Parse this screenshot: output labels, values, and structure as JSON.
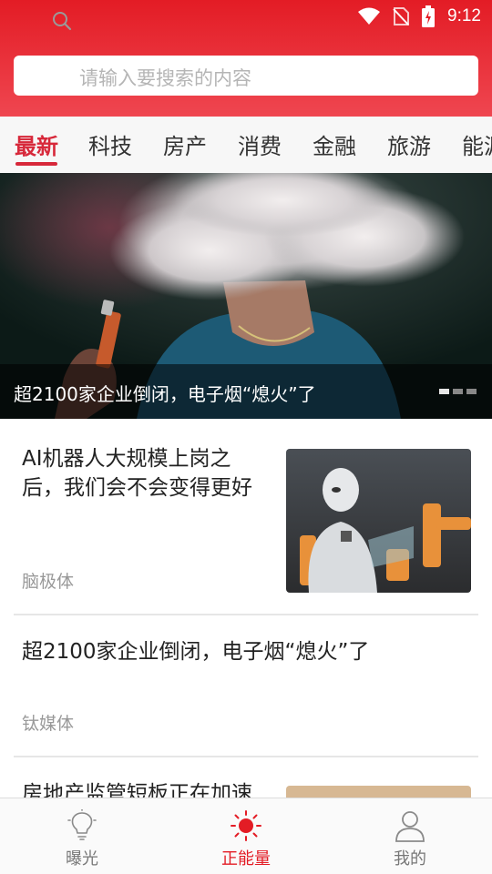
{
  "status_bar": {
    "time": "9:12",
    "icons": [
      "wifi-icon",
      "no-sim-icon",
      "battery-charging-icon"
    ]
  },
  "search": {
    "placeholder": "请输入要搜索的内容",
    "icon": "search-icon"
  },
  "tabs": [
    {
      "label": "最新",
      "active": true
    },
    {
      "label": "科技"
    },
    {
      "label": "房产"
    },
    {
      "label": "消费"
    },
    {
      "label": "金融"
    },
    {
      "label": "旅游"
    },
    {
      "label": "能源"
    }
  ],
  "banner": {
    "caption": "超2100家企业倒闭，电子烟“熄火”了",
    "slide_count": 3,
    "active_slide": 1
  },
  "news": [
    {
      "title_line1": "AI机器人大规模上岗之",
      "title_line2": "后，我们会不会变得更好",
      "source": "脑极体",
      "has_image": true
    },
    {
      "title_line1": "超2100家企业倒闭，电子烟“熄火”了",
      "source": "钛媒体",
      "has_image": false
    },
    {
      "title_line1": "房地产监管短板正在加速",
      "has_image": true
    }
  ],
  "bottom_nav": [
    {
      "label": "曝光",
      "icon": "lightbulb-icon"
    },
    {
      "label": "正能量",
      "icon": "sun-icon",
      "active": true
    },
    {
      "label": "我的",
      "icon": "user-icon"
    }
  ],
  "colors": {
    "accent": "#e31c25",
    "tab_active": "#d7283a",
    "header_gradient_end": "#ef4650"
  }
}
